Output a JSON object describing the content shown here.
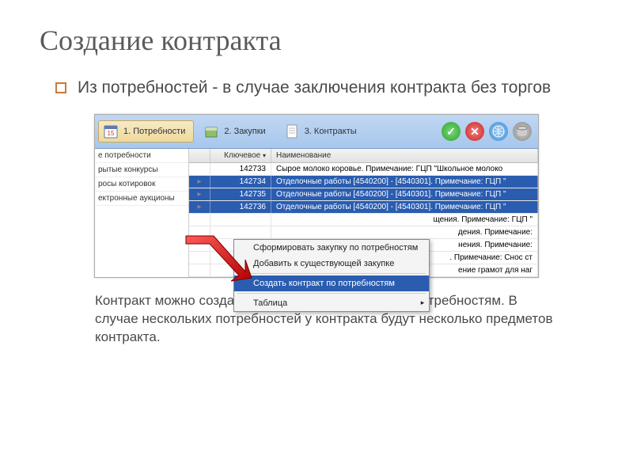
{
  "title": "Создание контракта",
  "bullet": "Из потребностей - в случае заключения контракта без торгов",
  "toolbar": {
    "tab1": "1. Потребности",
    "tab2": "2. Закупки",
    "tab3": "3. Контракты"
  },
  "left_panel": {
    "items": [
      "е потребности",
      "рытые конкурсы",
      "росы котировок",
      "ектронные аукционы"
    ]
  },
  "grid": {
    "col_key": "Ключевое",
    "col_name": "Наименование",
    "rows": [
      {
        "k": "142733",
        "n": "Сырое молоко коровье. Примечание: ГЦП \"Школьное молоко",
        "sel": false
      },
      {
        "k": "142734",
        "n": "Отделочные работы [4540200] - [4540301]. Примечание: ГЦП \"",
        "sel": true
      },
      {
        "k": "142735",
        "n": "Отделочные работы [4540200] - [4540301]. Примечание: ГЦП \"",
        "sel": true
      },
      {
        "k": "142736",
        "n": "Отделочные работы [4540200] - [4540301]. Примечание: ГЦП \"",
        "sel": true
      }
    ],
    "tails": [
      "щения. Примечание: ГЦП \"",
      "дения. Примечание:",
      "нения. Примечание:",
      ". Примечание: Снос ст",
      "ение грамот для наг"
    ]
  },
  "context_menu": {
    "i1": "Сформировать закупку по потребностям",
    "i2": "Добавить к существующей закупке",
    "i3": "Создать контракт по потребностям",
    "i4": "Таблица"
  },
  "footer": "Контракт можно создать по одной или нескольким потребностям. В случае нескольких потребностей у контракта будут несколько предметов контракта."
}
